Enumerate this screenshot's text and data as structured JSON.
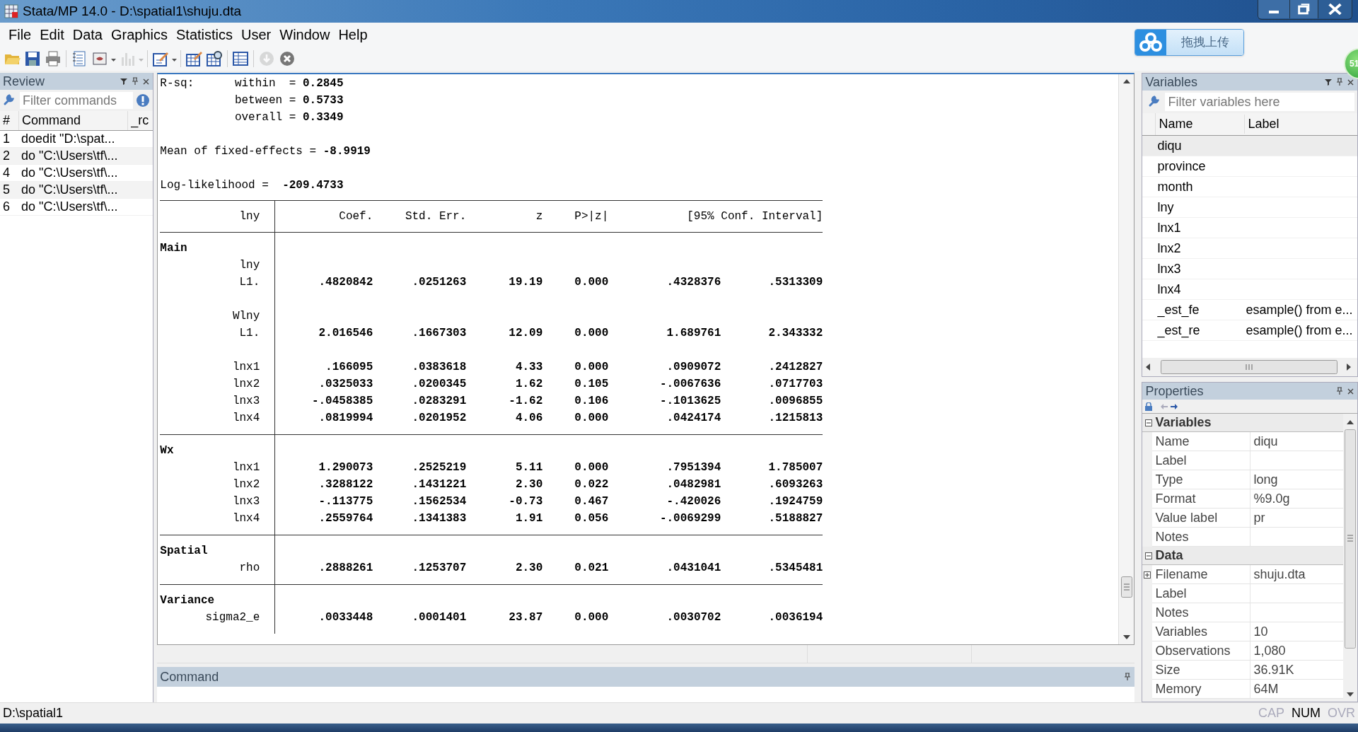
{
  "window": {
    "title": "Stata/MP 14.0 - D:\\spatial1\\shuju.dta"
  },
  "menu": [
    "File",
    "Edit",
    "Data",
    "Graphics",
    "Statistics",
    "User",
    "Window",
    "Help"
  ],
  "toolbar": [
    {
      "kind": "open",
      "disabled": false
    },
    {
      "kind": "save",
      "disabled": false
    },
    {
      "kind": "print",
      "disabled": false
    },
    {
      "kind": "sep"
    },
    {
      "kind": "log",
      "disabled": false
    },
    {
      "kind": "viewer",
      "disabled": false,
      "dropdown": true
    },
    {
      "kind": "graph",
      "disabled": true,
      "dropdown": true
    },
    {
      "kind": "sep"
    },
    {
      "kind": "dofile",
      "disabled": false,
      "dropdown": true
    },
    {
      "kind": "sep"
    },
    {
      "kind": "editor",
      "disabled": false
    },
    {
      "kind": "browser",
      "disabled": false
    },
    {
      "kind": "sep"
    },
    {
      "kind": "varmanager",
      "disabled": false
    },
    {
      "kind": "sep"
    },
    {
      "kind": "break",
      "disabled": true
    },
    {
      "kind": "clear",
      "disabled": false
    }
  ],
  "upload_button": {
    "label": "拖拽上传"
  },
  "badge": {
    "text": "51"
  },
  "review": {
    "title": "Review",
    "filter": {
      "placeholder": "Filter commands"
    },
    "columns": [
      "#",
      "Command",
      "_rc"
    ],
    "rows": [
      {
        "num": "1",
        "command": "doedit \"D:\\spat..."
      },
      {
        "num": "2",
        "command": "do \"C:\\Users\\tf\\..."
      },
      {
        "num": "4",
        "command": "do \"C:\\Users\\tf\\..."
      },
      {
        "num": "5",
        "command": "do \"C:\\Users\\tf\\..."
      },
      {
        "num": "6",
        "command": "do \"C:\\Users\\tf\\..."
      }
    ]
  },
  "results": {
    "header": [
      {
        "kind": "stat",
        "label": "R-sq:",
        "text": "within  = **0.2845**"
      },
      {
        "kind": "stat",
        "text": "between = **0.5733**"
      },
      {
        "kind": "stat",
        "text": "overall = **0.3349**"
      },
      {
        "kind": "blank"
      },
      {
        "kind": "line",
        "text": "Mean of fixed-effects = **-8.9919**"
      },
      {
        "kind": "blank"
      },
      {
        "kind": "line",
        "text": "Log-likelihood =  **-209.4733**"
      }
    ],
    "columns": [
      "lny",
      "Coef.",
      "Std. Err.",
      "z",
      "P>|z|",
      "[95% Conf. Interval]"
    ],
    "sections": [
      {
        "rows": [
          {
            "kind": "section",
            "name": "Main"
          },
          {
            "kind": "var",
            "name": "lny"
          },
          {
            "kind": "row",
            "name": "L1.",
            "values": [
              ".4820842",
              ".0251263",
              "19.19",
              "0.000",
              ".4328376",
              ".5313309"
            ]
          },
          {
            "kind": "blank"
          },
          {
            "kind": "var",
            "name": "Wlny"
          },
          {
            "kind": "row",
            "name": "L1.",
            "values": [
              "2.016546",
              ".1667303",
              "12.09",
              "0.000",
              "1.689761",
              "2.343332"
            ]
          },
          {
            "kind": "blank"
          },
          {
            "kind": "row",
            "name": "lnx1",
            "values": [
              ".166095",
              ".0383618",
              "4.33",
              "0.000",
              ".0909072",
              ".2412827"
            ]
          },
          {
            "kind": "row",
            "name": "lnx2",
            "values": [
              ".0325033",
              ".0200345",
              "1.62",
              "0.105",
              "-.0067636",
              ".0717703"
            ]
          },
          {
            "kind": "row",
            "name": "lnx3",
            "values": [
              "-.0458385",
              ".0283291",
              "-1.62",
              "0.106",
              "-.1013625",
              ".0096855"
            ]
          },
          {
            "kind": "row",
            "name": "lnx4",
            "values": [
              ".0819994",
              ".0201952",
              "4.06",
              "0.000",
              ".0424174",
              ".1215813"
            ]
          }
        ]
      },
      {
        "rows": [
          {
            "kind": "section",
            "name": "Wx"
          },
          {
            "kind": "row",
            "name": "lnx1",
            "values": [
              "1.290073",
              ".2525219",
              "5.11",
              "0.000",
              ".7951394",
              "1.785007"
            ]
          },
          {
            "kind": "row",
            "name": "lnx2",
            "values": [
              ".3288122",
              ".1431221",
              "2.30",
              "0.022",
              ".0482981",
              ".6093263"
            ]
          },
          {
            "kind": "row",
            "name": "lnx3",
            "values": [
              "-.113775",
              ".1562534",
              "-0.73",
              "0.467",
              "-.420026",
              ".1924759"
            ]
          },
          {
            "kind": "row",
            "name": "lnx4",
            "values": [
              ".2559764",
              ".1341383",
              "1.91",
              "0.056",
              "-.0069299",
              ".5188827"
            ]
          }
        ]
      },
      {
        "rows": [
          {
            "kind": "section",
            "name": "Spatial"
          },
          {
            "kind": "row",
            "name": "rho",
            "values": [
              ".2888261",
              ".1253707",
              "2.30",
              "0.021",
              ".0431041",
              ".5345481"
            ]
          }
        ]
      },
      {
        "rows": [
          {
            "kind": "section",
            "name": "Variance"
          },
          {
            "kind": "row",
            "name": "sigma2_e",
            "values": [
              ".0033448",
              ".0001401",
              "23.87",
              "0.000",
              ".0030702",
              ".0036194"
            ]
          }
        ]
      }
    ]
  },
  "command": {
    "title": "Command"
  },
  "variables": {
    "title": "Variables",
    "filter": {
      "placeholder": "Filter variables here"
    },
    "columns": [
      "Name",
      "Label"
    ],
    "rows": [
      {
        "name": "diqu",
        "selected": true
      },
      {
        "name": "province",
        "selected": false
      },
      {
        "name": "month",
        "selected": false
      },
      {
        "name": "lny",
        "selected": false
      },
      {
        "name": "lnx1",
        "selected": false
      },
      {
        "name": "lnx2",
        "selected": false
      },
      {
        "name": "lnx3",
        "selected": false
      },
      {
        "name": "lnx4",
        "selected": false
      },
      {
        "name": "_est_fe",
        "label": "esample() from e...",
        "selected": false
      },
      {
        "name": "_est_re",
        "label": "esample() from e...",
        "selected": false
      }
    ]
  },
  "properties": {
    "title": "Properties",
    "groups": [
      {
        "title": "Variables",
        "expanded": true,
        "rows": [
          {
            "key": "Name",
            "value": "diqu"
          },
          {
            "key": "Label"
          },
          {
            "key": "Type",
            "value": "long"
          },
          {
            "key": "Format",
            "value": "%9.0g"
          },
          {
            "key": "Value label",
            "value": "pr"
          },
          {
            "key": "Notes"
          }
        ]
      },
      {
        "title": "Data",
        "expanded": true,
        "rows": [
          {
            "key": "Filename",
            "value": "shuju.dta",
            "expanded": false
          },
          {
            "key": "Label"
          },
          {
            "key": "Notes"
          },
          {
            "key": "Variables",
            "value": "10"
          },
          {
            "key": "Observations",
            "value": "1,080"
          },
          {
            "key": "Size",
            "value": "36.91K"
          },
          {
            "key": "Memory",
            "value": "64M"
          }
        ]
      }
    ]
  },
  "status_bar": {
    "path": "D:\\spatial1",
    "indicators": [
      {
        "label": "CAP",
        "on": false
      },
      {
        "label": "NUM",
        "on": true
      },
      {
        "label": "OVR",
        "on": false
      }
    ]
  }
}
